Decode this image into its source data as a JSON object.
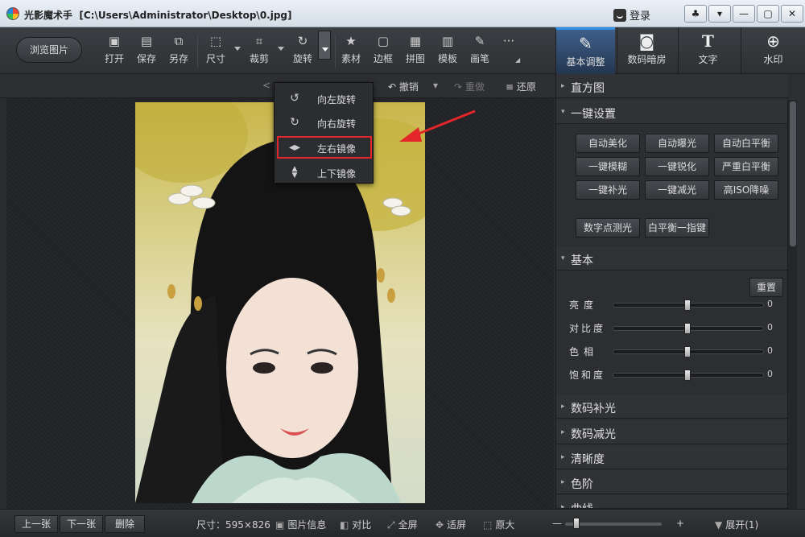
{
  "titlebar": {
    "app_name": "光影魔术手",
    "file_path": "[C:\\Users\\Administrator\\Desktop\\0.jpg]",
    "login_label": "登录",
    "buttons": [
      "♣",
      "▾",
      "—",
      "▢",
      "✕"
    ]
  },
  "toolbar": {
    "browse_label": "浏览图片",
    "tools": [
      {
        "label": "打开",
        "icon": "open-icon"
      },
      {
        "label": "保存",
        "icon": "save-icon"
      },
      {
        "label": "另存",
        "icon": "save-as-icon"
      },
      {
        "label": "尺寸",
        "icon": "resize-icon"
      },
      {
        "label": "裁剪",
        "icon": "crop-icon"
      },
      {
        "label": "旋转",
        "icon": "rotate-icon"
      },
      {
        "label": "素材",
        "icon": "material-icon"
      },
      {
        "label": "边框",
        "icon": "frame-icon"
      },
      {
        "label": "拼图",
        "icon": "collage-icon"
      },
      {
        "label": "模板",
        "icon": "template-icon"
      },
      {
        "label": "画笔",
        "icon": "brush-icon"
      },
      {
        "label": "···",
        "icon": "more-icon"
      }
    ]
  },
  "right_tabs": [
    {
      "label": "基本调整",
      "icon": "adjust-icon",
      "active": true
    },
    {
      "label": "数码暗房",
      "icon": "camera-icon",
      "active": false
    },
    {
      "label": "文字",
      "icon": "text-icon",
      "active": false
    },
    {
      "label": "水印",
      "icon": "watermark-icon",
      "active": false
    }
  ],
  "subbar": {
    "undo": "撤销",
    "redo": "重做",
    "restore": "还原"
  },
  "rotate_menu": {
    "items": [
      {
        "label": "向左旋转",
        "icon": "rotate-left-icon"
      },
      {
        "label": "向右旋转",
        "icon": "rotate-right-icon"
      },
      {
        "label": "左右镜像",
        "icon": "flip-horizontal-icon"
      },
      {
        "label": "上下镜像",
        "icon": "flip-vertical-icon"
      }
    ],
    "highlighted": "左右镜像"
  },
  "right_panel": {
    "histogram": "直方图",
    "one_click": {
      "title": "一键设置",
      "buttons": [
        "自动美化",
        "自动曝光",
        "自动白平衡",
        "一键模糊",
        "一键锐化",
        "严重白平衡",
        "一键补光",
        "一键减光",
        "高ISO降噪",
        "数字点测光",
        "白平衡一指键"
      ]
    },
    "basic": {
      "title": "基本",
      "reset_label": "重置",
      "sliders": [
        {
          "label": "亮度",
          "value": "0"
        },
        {
          "label": "对比度",
          "value": "0"
        },
        {
          "label": "色相",
          "value": "0"
        },
        {
          "label": "饱和度",
          "value": "0"
        }
      ]
    },
    "sections": [
      "数码补光",
      "数码减光",
      "清晰度",
      "色阶",
      "曲线"
    ]
  },
  "statusbar": {
    "prev": "上一张",
    "next": "下一张",
    "delete": "删除",
    "size": "尺寸：595×826",
    "image_info": "图片信息",
    "compare": "对比",
    "fullscreen": "全屏",
    "fit": "适屏",
    "original": "原大",
    "zoom_minus": "—",
    "zoom_plus": "+",
    "expand": "展开(1)"
  },
  "colors": {
    "accent": "#2e8ee8",
    "highlight_box": "#e3262a",
    "annotation_arrow": "#e3262a"
  }
}
